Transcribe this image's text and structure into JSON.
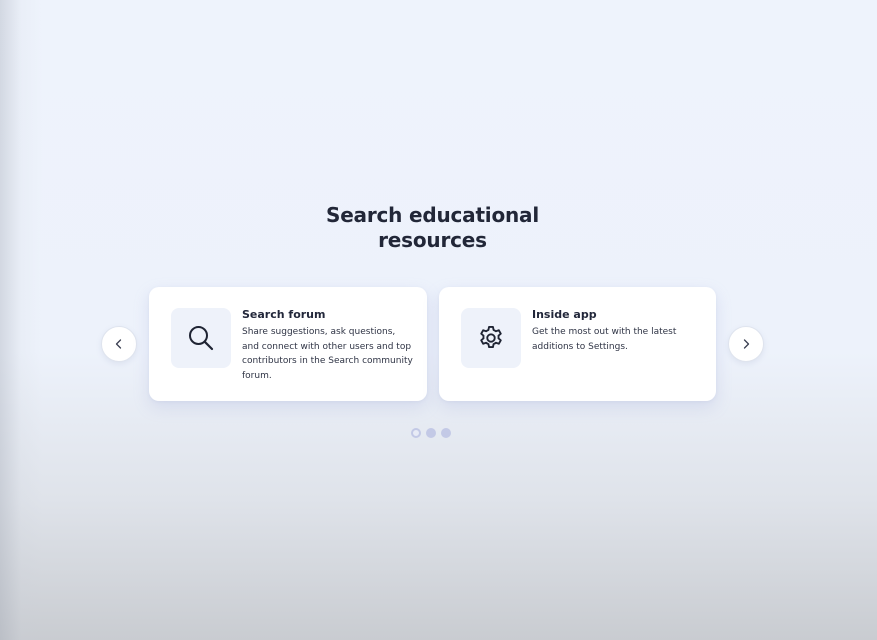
{
  "heading": {
    "line1": "Search educational",
    "line2": "resources"
  },
  "cards": [
    {
      "title": "Search forum",
      "description": "Share suggestions, ask questions, and connect with other users and top contributors in the Search community forum.",
      "icon": "search-icon"
    },
    {
      "title": "Inside app",
      "description": "Get the most out with the latest additions to Settings.",
      "icon": "gear-icon"
    }
  ],
  "carousel": {
    "prev_icon": "chevron-left-icon",
    "next_icon": "chevron-right-icon",
    "page_count": 3,
    "active_page": 1
  },
  "colors": {
    "text": "#222738",
    "card_bg": "#ffffff",
    "icon_tile_bg": "#eef2fa",
    "dot_color": "#c3c9e6"
  }
}
